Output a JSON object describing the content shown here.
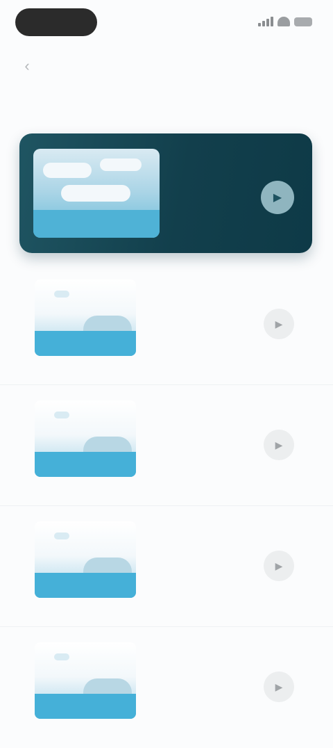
{
  "status_bar": {
    "signal_icon": "signal-icon",
    "wifi_icon": "wifi-icon",
    "battery_icon": "battery-icon"
  },
  "header": {
    "back_icon": "‹",
    "title": ""
  },
  "section": {
    "label": ""
  },
  "featured": {
    "title": "",
    "subtitle": "",
    "meta": "",
    "play_icon": "▶"
  },
  "items": [
    {
      "title": "",
      "subtitle": "",
      "meta": "",
      "play_icon": "▶"
    },
    {
      "title": "",
      "subtitle": "",
      "meta": "",
      "play_icon": "▶"
    },
    {
      "title": "",
      "subtitle": "",
      "meta": "",
      "play_icon": "▶"
    },
    {
      "title": "",
      "subtitle": "",
      "meta": "",
      "play_icon": "▶"
    }
  ],
  "colors": {
    "background": "#fbfcfd",
    "featured_card": "#123f4c",
    "thumb_water": "#45b0d8",
    "play_button_bg": "#eceeef"
  }
}
